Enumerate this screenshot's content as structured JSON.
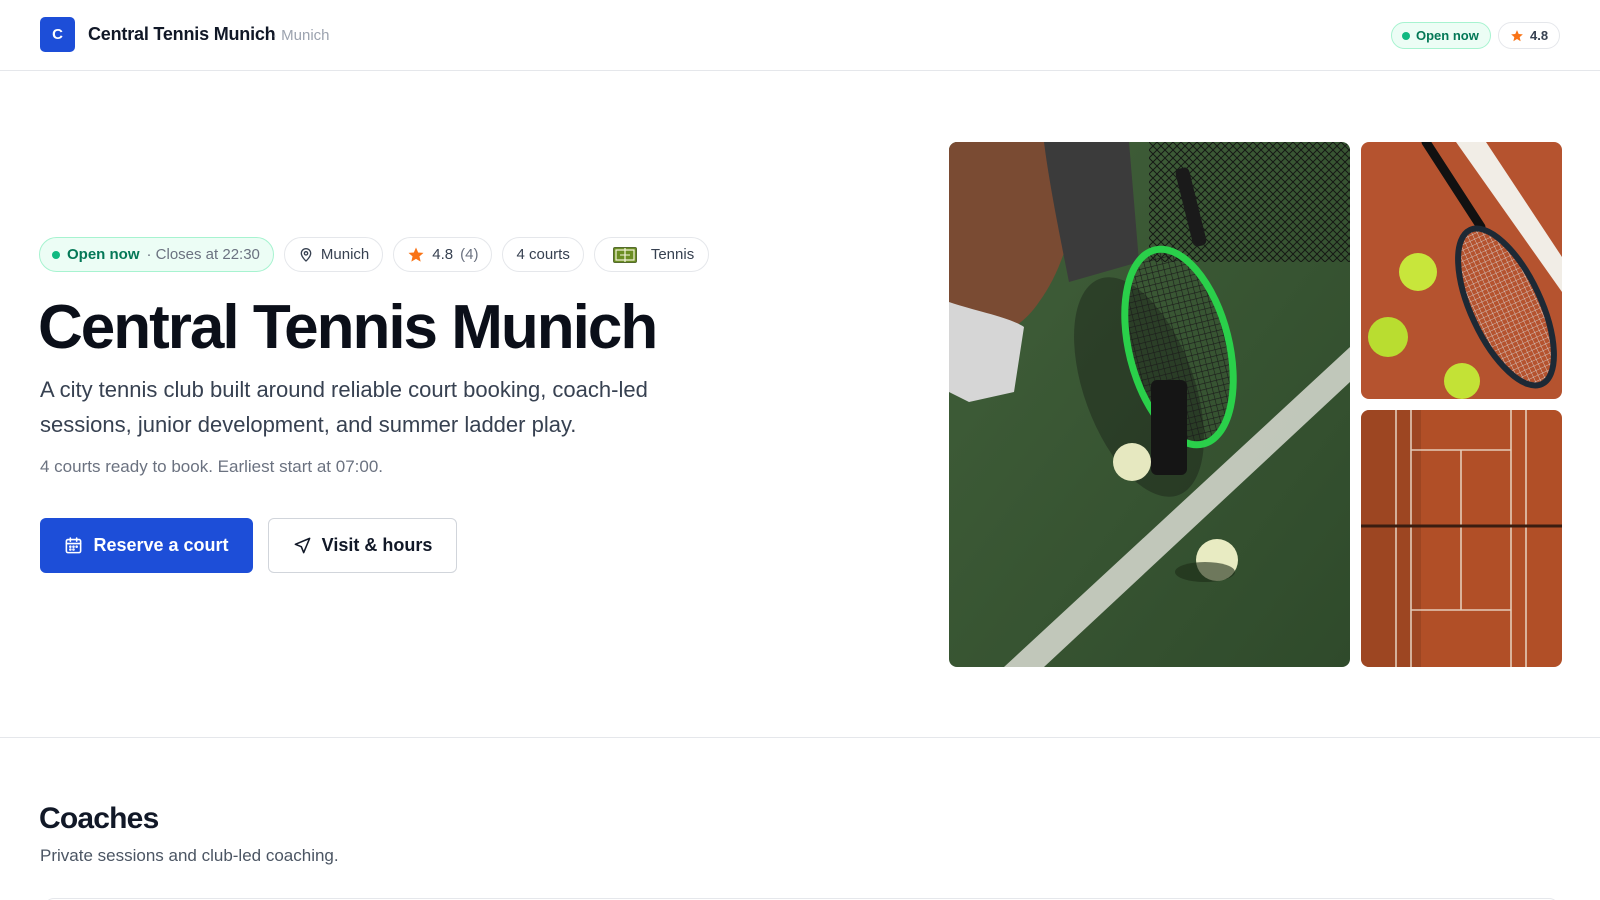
{
  "header": {
    "logo_letter": "C",
    "brand_name": "Central Tennis Munich",
    "brand_city": "· Munich",
    "status_label": "Open now",
    "rating": "4.8"
  },
  "hero": {
    "pills": {
      "open_label": "Open now",
      "closes_label": "· Closes at 22:30",
      "location": "Munich",
      "rating": "4.8",
      "rating_count": "(4)",
      "courts": "4 courts",
      "sport": "Tennis"
    },
    "title": "Central Tennis Munich",
    "description": "A city tennis club built around reliable court booking, coach-led sessions, junior development, and summer ladder play.",
    "note": "4 courts ready to book. Earliest start at 07:00.",
    "primary_button": "Reserve a court",
    "secondary_button": "Visit & hours"
  },
  "coaches": {
    "title": "Coaches",
    "subtitle": "Private sessions and club-led coaching."
  },
  "colors": {
    "accent": "#1d4ed8",
    "open_green": "#047857",
    "star_orange": "#f97316"
  }
}
